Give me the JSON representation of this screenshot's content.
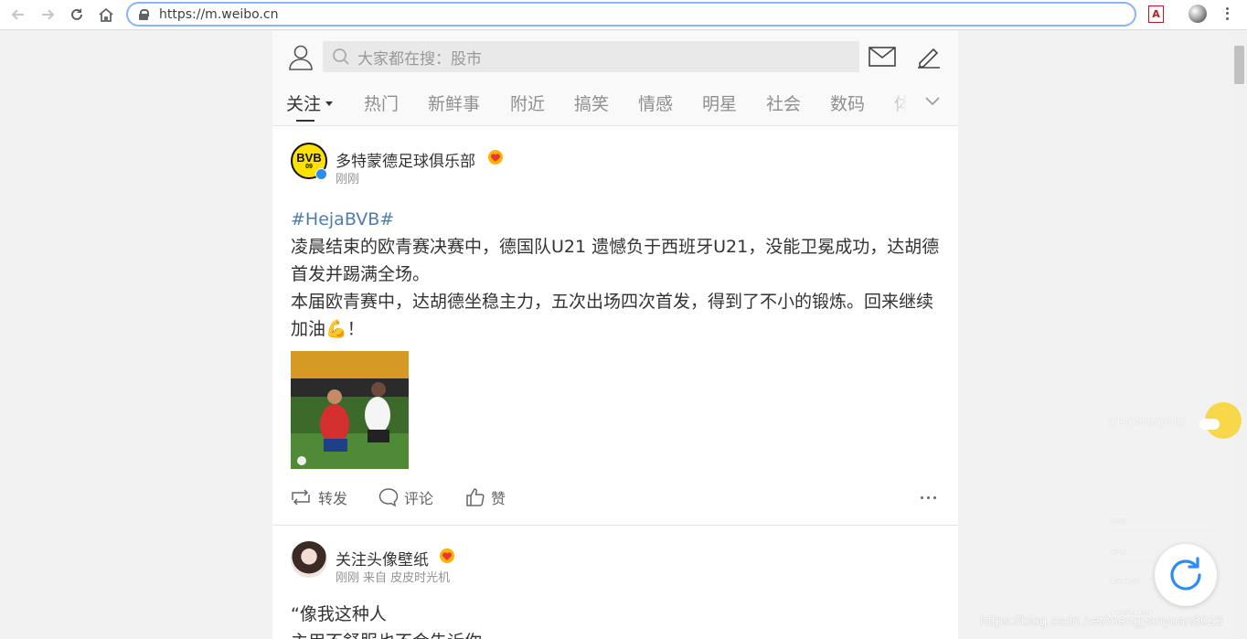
{
  "browser": {
    "url": "https://m.weibo.cn",
    "pdf_ext_label": "A"
  },
  "desktop": {
    "weather_city": "CHONGQING",
    "sysmon_labels": [
      "RAM",
      "CPU",
      "UPLOAD",
      "DOWNLOAD"
    ]
  },
  "header": {
    "search_placeholder": "大家都在搜：股市",
    "tabs": [
      "关注",
      "热门",
      "新鲜事",
      "附近",
      "搞笑",
      "情感",
      "明星",
      "社会",
      "数码",
      "体"
    ]
  },
  "posts": [
    {
      "user": "多特蒙德足球俱乐部",
      "avatar_text": "BVB",
      "avatar_sub": "09",
      "time": "刚刚",
      "source": "",
      "hashtag": "#HejaBVB#",
      "text_line1": "凌晨结束的欧青赛决赛中，德国队U21 遗憾负于西班牙U21，没能卫冕成功，达胡德首发并踢满全场。",
      "text_line2": "本届欧青赛中，达胡德坐稳主力，五次出场四次首发，得到了不小的锻炼。回来继续加油💪！",
      "actions": {
        "repost": "转发",
        "comment": "评论",
        "like": "赞"
      }
    },
    {
      "user": "关注头像壁纸",
      "time": "刚刚",
      "source": "来自 皮皮时光机",
      "text_line1": "“像我这种人",
      "text_line2": "主用不舒服也不会告诉你"
    }
  ],
  "watermark": "https://blog.csdn.net/mengyanyuan8023",
  "colors": {
    "link": "#507daf",
    "refresh": "#2d8cf0",
    "bvb_yellow": "#fde100"
  }
}
